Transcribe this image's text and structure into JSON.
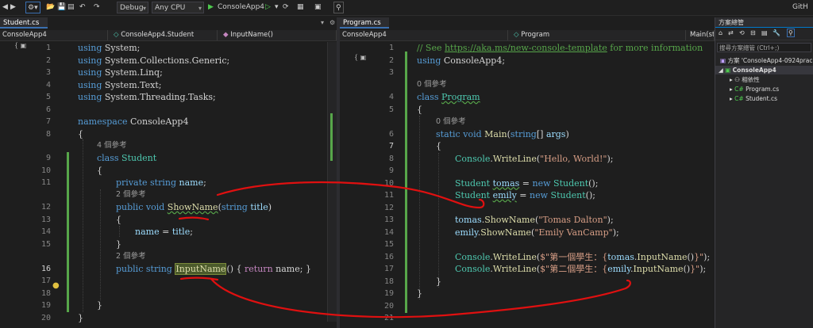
{
  "toolbar": {
    "config": "Debug",
    "platform": "Any CPU",
    "run_target": "ConsoleApp4",
    "right_label": "GitH"
  },
  "left_pane": {
    "tab": "Student.cs",
    "nav": [
      "ConsoleApp4",
      "ConsoleApp4.Student",
      "InputName()"
    ],
    "line_numbers": [
      "1",
      "2",
      "3",
      "4",
      "5",
      "6",
      "7",
      "8",
      "9",
      "10",
      "11",
      "12",
      "13",
      "14",
      "15",
      "16",
      "17",
      "18",
      "19",
      "20"
    ],
    "current_line": "16",
    "code": {
      "l1": [
        "using",
        " System;"
      ],
      "l2": [
        "using",
        " System.Collections.Generic;"
      ],
      "l3": [
        "using",
        " System.Linq;"
      ],
      "l4": [
        "using",
        " System.Text;"
      ],
      "l5": [
        "using",
        " System.Threading.Tasks;"
      ],
      "l7": [
        "namespace",
        " ConsoleApp4"
      ],
      "l8": "{",
      "lens9": "4 個參考",
      "l9": [
        "class",
        " ",
        "Student"
      ],
      "l10": "{",
      "l11": [
        "private",
        " ",
        "string",
        " ",
        "name",
        ";"
      ],
      "lens12": "2 個參考",
      "l12": [
        "public",
        " ",
        "void",
        " ",
        "ShowName",
        "(",
        "string",
        " ",
        "title",
        ")"
      ],
      "l13": "{",
      "l14": [
        "name",
        " = ",
        "title",
        ";"
      ],
      "l15": "}",
      "lens16": "2 個參考",
      "l16": [
        "public",
        " ",
        "string",
        " ",
        "InputName",
        "() { ",
        "return",
        " name; }"
      ],
      "l19": "}",
      "l20": "}"
    }
  },
  "right_pane": {
    "tab": "Program.cs",
    "nav": [
      "ConsoleApp4",
      "Program",
      "Main(strin"
    ],
    "line_numbers": [
      "1",
      "2",
      "3",
      "4",
      "5",
      "6",
      "7",
      "8",
      "9",
      "10",
      "11",
      "12",
      "13",
      "14",
      "15",
      "16",
      "17",
      "18",
      "19",
      "20",
      "21"
    ],
    "current_line": "7",
    "code": {
      "l1": [
        "// See ",
        "https://aka.ms/new-console-template",
        " for more information"
      ],
      "l2": [
        "using",
        " ConsoleApp4;"
      ],
      "lens4": "0 個參考",
      "l4": [
        "class",
        " ",
        "Program"
      ],
      "l5": "{",
      "lens6": "0 個參考",
      "l6": [
        "static",
        " ",
        "void",
        " ",
        "Main",
        "(",
        "string",
        "[] ",
        "args",
        ")"
      ],
      "l7": "{",
      "l8": [
        "Console",
        ".",
        "WriteLine",
        "(",
        "\"Hello, World!\"",
        ");"
      ],
      "l10": [
        "Student",
        " ",
        "tomas",
        " = ",
        "new",
        " ",
        "Student",
        "();"
      ],
      "l11": [
        "Student",
        " ",
        "emily",
        " = ",
        "new",
        " ",
        "Student",
        "();"
      ],
      "l13": [
        "tomas",
        ".",
        "ShowName",
        "(",
        "\"Tomas Dalton\"",
        ");"
      ],
      "l14": [
        "emily",
        ".",
        "ShowName",
        "(",
        "\"Emily VanCamp\"",
        ");"
      ],
      "l16": [
        "Console",
        ".",
        "WriteLine",
        "(",
        "$\"第一個學生：{",
        "tomas",
        ".",
        "InputName",
        "()",
        "}\"",
        ");"
      ],
      "l17": [
        "Console",
        ".",
        "WriteLine",
        "(",
        "$\"第二個學生：{",
        "emily",
        ".",
        "InputName",
        "()",
        "}\"",
        ");"
      ],
      "l18": "}",
      "l19": "}"
    }
  },
  "solution_explorer": {
    "title": "方案總管",
    "search_placeholder": "搜尋方案總管 (Ctrl+;)",
    "items": [
      {
        "label": "方案 'ConsoleApp4-0924prac"
      },
      {
        "label": "ConsoleApp4"
      },
      {
        "label": "相依性"
      },
      {
        "label": "Program.cs"
      },
      {
        "label": "Student.cs"
      }
    ]
  },
  "colors": {
    "keyword": "#569cd6",
    "type": "#4ec9b0",
    "string": "#d69d85",
    "method": "#dcdcaa",
    "variable": "#9cdcfe",
    "comment": "#57a64a",
    "annotation_red": "#e01010"
  }
}
